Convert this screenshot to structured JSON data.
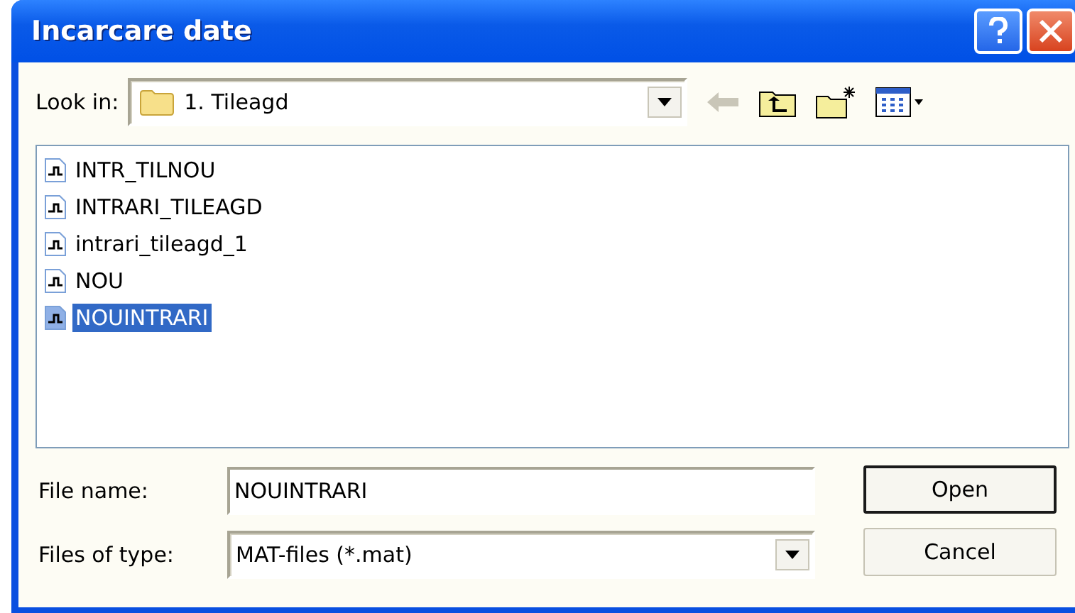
{
  "window": {
    "title": "Incarcare date"
  },
  "look_in": {
    "label": "Look in:",
    "value": "1. Tileagd"
  },
  "files": [
    {
      "name": "INTR_TILNOU",
      "selected": false
    },
    {
      "name": "INTRARI_TILEAGD",
      "selected": false
    },
    {
      "name": "intrari_tileagd_1",
      "selected": false
    },
    {
      "name": "NOU",
      "selected": false
    },
    {
      "name": "NOUINTRARI",
      "selected": true
    }
  ],
  "file_name": {
    "label": "File name:",
    "value": "NOUINTRARI"
  },
  "file_type": {
    "label": "Files of type:",
    "value": "MAT-files (*.mat)"
  },
  "buttons": [
    {
      "label": "Open",
      "default": true
    },
    {
      "label": "Cancel",
      "default": false
    }
  ]
}
